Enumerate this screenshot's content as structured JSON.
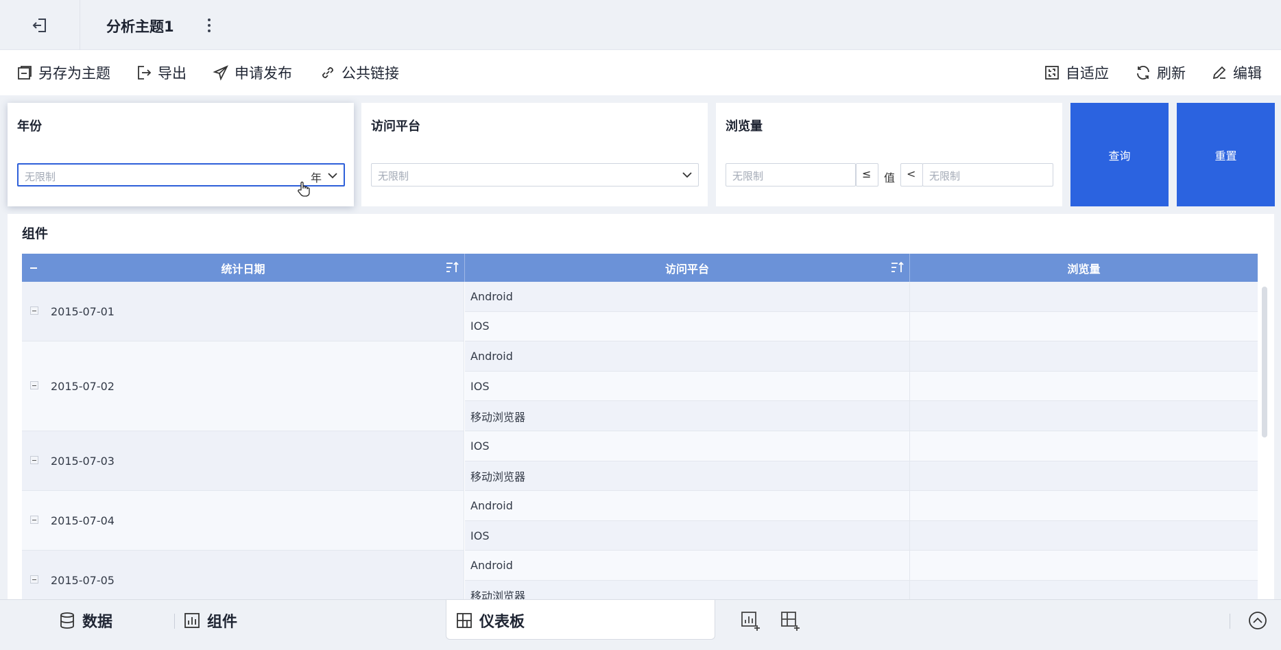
{
  "header": {
    "title": "分析主题1"
  },
  "toolbar": {
    "left": [
      {
        "label": "另存为主题",
        "icon": "save-icon"
      },
      {
        "label": "导出",
        "icon": "export-icon"
      },
      {
        "label": "申请发布",
        "icon": "send-icon"
      },
      {
        "label": "公共链接",
        "icon": "link-icon"
      }
    ],
    "right": [
      {
        "label": "自适应",
        "icon": "fit-icon"
      },
      {
        "label": "刷新",
        "icon": "refresh-icon"
      },
      {
        "label": "编辑",
        "icon": "edit-icon"
      }
    ]
  },
  "filters": {
    "year": {
      "label": "年份",
      "placeholder": "无限制",
      "unit": "年"
    },
    "platform": {
      "label": "访问平台",
      "placeholder": "无限制"
    },
    "views": {
      "label": "浏览量",
      "min_placeholder": "无限制",
      "op_left": "≤",
      "value_label": "值",
      "op_right": "<",
      "max_placeholder": "无限制"
    },
    "query_button": "查询",
    "reset_button": "重置"
  },
  "component": {
    "title": "组件",
    "columns": [
      "统计日期",
      "访问平台",
      "浏览量"
    ],
    "groups": [
      {
        "date": "2015-07-01",
        "platforms": [
          "Android",
          "IOS"
        ]
      },
      {
        "date": "2015-07-02",
        "platforms": [
          "Android",
          "IOS",
          "移动浏览器"
        ]
      },
      {
        "date": "2015-07-03",
        "platforms": [
          "IOS",
          "移动浏览器"
        ]
      },
      {
        "date": "2015-07-04",
        "platforms": [
          "Android",
          "IOS"
        ]
      },
      {
        "date": "2015-07-05",
        "platforms": [
          "Android",
          "移动浏览器"
        ]
      }
    ]
  },
  "bottom": {
    "data_tab": "数据",
    "component_tab": "组件",
    "dashboard_tab": "仪表板"
  },
  "colors": {
    "accent": "#2b63e0",
    "table_header": "#6b92d8"
  }
}
